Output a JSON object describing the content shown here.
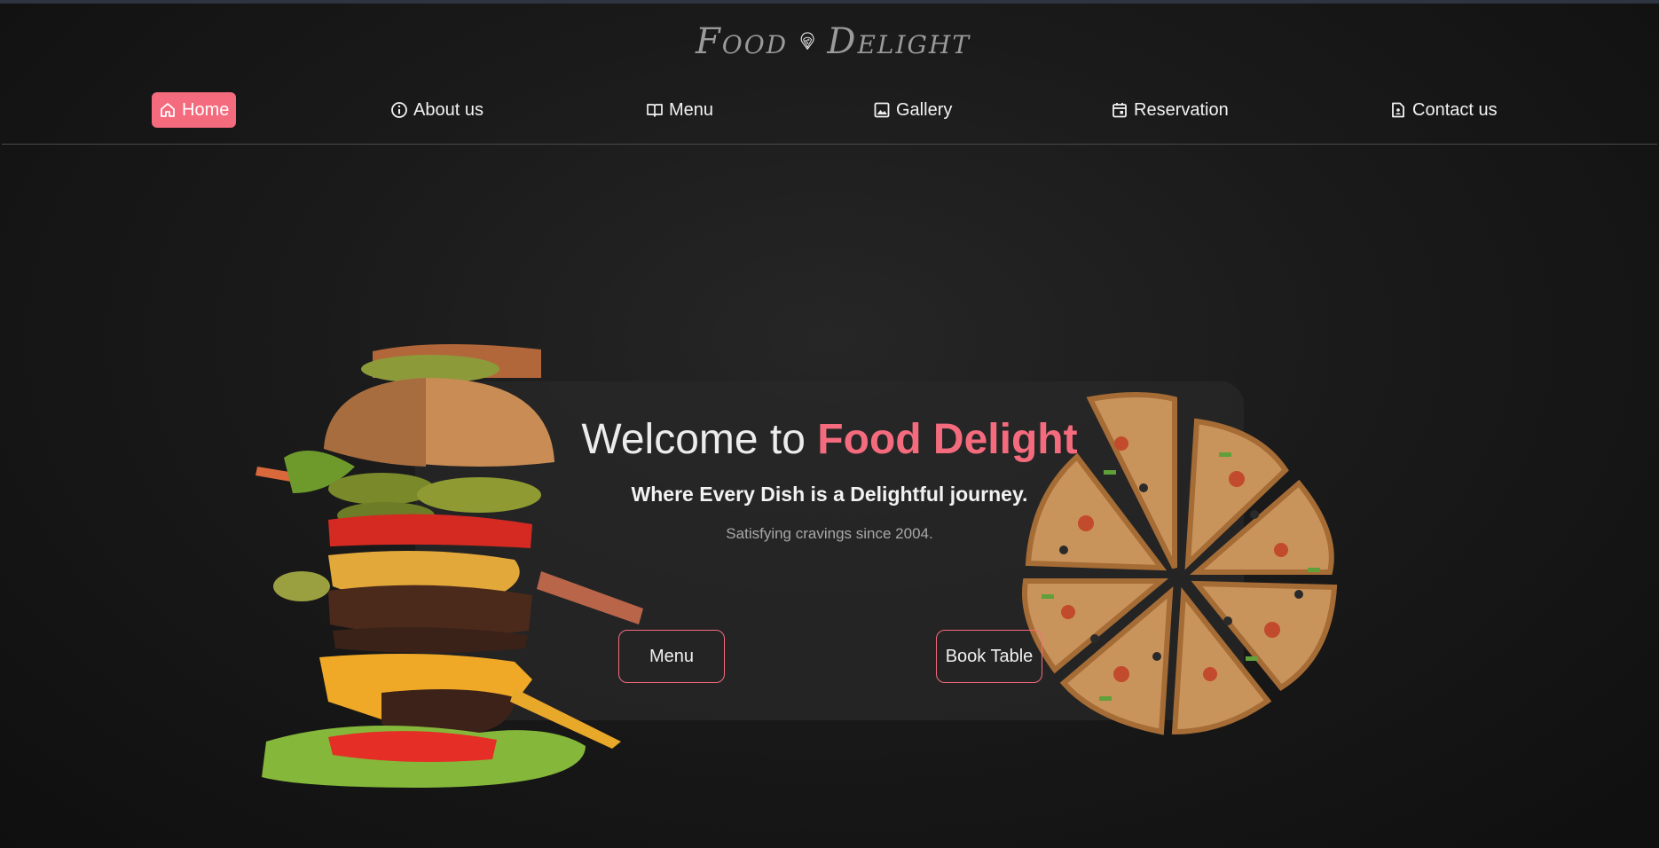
{
  "brand": {
    "word_left": "Food",
    "word_right": "Delight"
  },
  "nav": {
    "items": [
      {
        "label": "Home",
        "icon": "home-icon",
        "active": true
      },
      {
        "label": "About us",
        "icon": "info-icon",
        "active": false
      },
      {
        "label": "Menu",
        "icon": "book-icon",
        "active": false
      },
      {
        "label": "Gallery",
        "icon": "image-icon",
        "active": false
      },
      {
        "label": "Reservation",
        "icon": "calendar-icon",
        "active": false
      },
      {
        "label": "Contact us",
        "icon": "contact-file-icon",
        "active": false
      }
    ]
  },
  "hero": {
    "title_prefix": "Welcome to ",
    "title_accent": "Food Delight",
    "subtitle": "Where Every Dish is a Delightful journey.",
    "tagline": "Satisfying cravings since 2004.",
    "menu_button": "Menu",
    "book_button": "Book Table"
  },
  "colors": {
    "accent": "#f56b7e",
    "background": "#141414"
  }
}
